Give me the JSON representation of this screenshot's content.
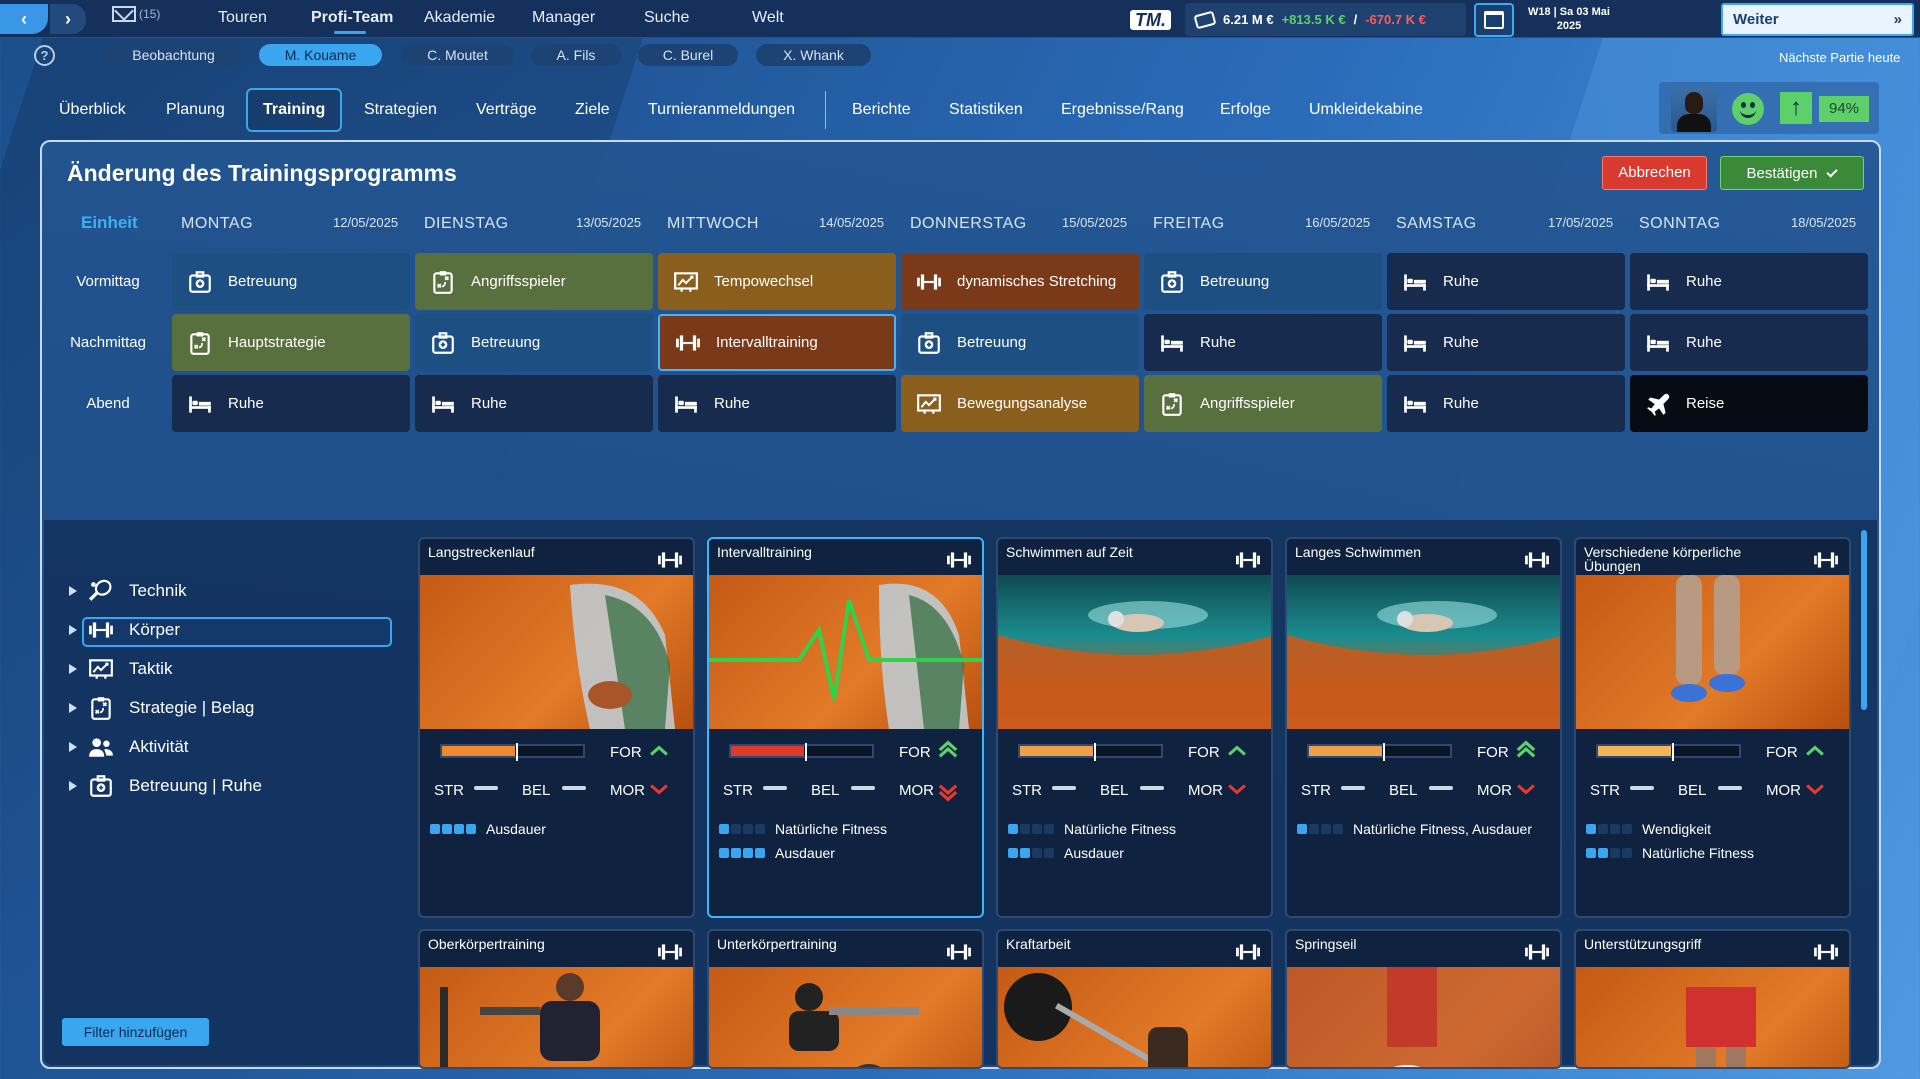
{
  "topbar": {
    "mail_count": "(15)",
    "nav": [
      "Touren",
      "Profi-Team",
      "Akademie",
      "Manager",
      "Suche",
      "Welt"
    ],
    "active_nav": "Profi-Team",
    "logo": "TM.",
    "finance": {
      "balance": "6.21 M €",
      "income": "+813.5 K €",
      "divider": "/",
      "expense": "-670.7 K €"
    },
    "date_line1": "W18 | Sa 03 Mai",
    "date_line2": "2025",
    "continue_label": "Weiter",
    "continue_icon": "»"
  },
  "players": {
    "help": "?",
    "tabs": [
      "Beobachtung",
      "M. Kouame",
      "C. Moutet",
      "A. Fils",
      "C. Burel",
      "X. Whank"
    ],
    "active": "M. Kouame",
    "next_match": "Nächste Partie heute"
  },
  "subtabs": {
    "items": [
      "Überblick",
      "Planung",
      "Training",
      "Strategien",
      "Verträge",
      "Ziele",
      "Turnieranmeldungen",
      "Berichte",
      "Statistiken",
      "Ergebnisse/Rang",
      "Erfolge",
      "Umkleidekabine"
    ],
    "active": "Training"
  },
  "player_status": {
    "form_pct": "94%",
    "mood": "happy",
    "trend": "up",
    "colors": {
      "good": "#5ed06a"
    }
  },
  "schedule": {
    "title": "Änderung des Trainingsprogramms",
    "cancel": "Abbrechen",
    "confirm": "Bestätigen",
    "unit_label": "Einheit",
    "days": [
      {
        "name": "MONTAG",
        "date": "12/05/2025"
      },
      {
        "name": "DIENSTAG",
        "date": "13/05/2025"
      },
      {
        "name": "MITTWOCH",
        "date": "14/05/2025"
      },
      {
        "name": "DONNERSTAG",
        "date": "15/05/2025"
      },
      {
        "name": "FREITAG",
        "date": "16/05/2025"
      },
      {
        "name": "SAMSTAG",
        "date": "17/05/2025"
      },
      {
        "name": "SONNTAG",
        "date": "18/05/2025"
      }
    ],
    "slots": [
      "Vormittag",
      "Nachmittag",
      "Abend"
    ],
    "grid": [
      [
        {
          "label": "Betreuung",
          "icon": "medkit-icon",
          "color": "blue"
        },
        {
          "label": "Angriffsspieler",
          "icon": "clipboard-icon",
          "color": "green"
        },
        {
          "label": "Tempowechsel",
          "icon": "tactics-board-icon",
          "color": "orange"
        },
        {
          "label": "dynamisches Stretching",
          "icon": "dumbbell-icon",
          "color": "brown"
        },
        {
          "label": "Betreuung",
          "icon": "medkit-icon",
          "color": "blue"
        },
        {
          "label": "Ruhe",
          "icon": "bed-icon",
          "color": "dark"
        },
        {
          "label": "Ruhe",
          "icon": "bed-icon",
          "color": "dark"
        }
      ],
      [
        {
          "label": "Hauptstrategie",
          "icon": "clipboard-icon",
          "color": "green"
        },
        {
          "label": "Betreuung",
          "icon": "medkit-icon",
          "color": "blue"
        },
        {
          "label": "Intervalltraining",
          "icon": "dumbbell-icon",
          "color": "brown",
          "selected": true
        },
        {
          "label": "Betreuung",
          "icon": "medkit-icon",
          "color": "blue"
        },
        {
          "label": "Ruhe",
          "icon": "bed-icon",
          "color": "dark"
        },
        {
          "label": "Ruhe",
          "icon": "bed-icon",
          "color": "dark"
        },
        {
          "label": "Ruhe",
          "icon": "bed-icon",
          "color": "dark"
        }
      ],
      [
        {
          "label": "Ruhe",
          "icon": "bed-icon",
          "color": "dark"
        },
        {
          "label": "Ruhe",
          "icon": "bed-icon",
          "color": "dark"
        },
        {
          "label": "Ruhe",
          "icon": "bed-icon",
          "color": "dark"
        },
        {
          "label": "Bewegungsanalyse",
          "icon": "tactics-board-icon",
          "color": "orange"
        },
        {
          "label": "Angriffsspieler",
          "icon": "clipboard-icon",
          "color": "green"
        },
        {
          "label": "Ruhe",
          "icon": "bed-icon",
          "color": "dark"
        },
        {
          "label": "Reise",
          "icon": "airplane-icon",
          "color": "black"
        }
      ]
    ]
  },
  "categories": {
    "items": [
      {
        "label": "Technik",
        "icon": "racket-icon"
      },
      {
        "label": "Körper",
        "icon": "dumbbell-icon"
      },
      {
        "label": "Taktik",
        "icon": "tactics-board-icon"
      },
      {
        "label": "Strategie | Belag",
        "icon": "clipboard-icon"
      },
      {
        "label": "Aktivität",
        "icon": "people-icon"
      },
      {
        "label": "Betreuung | Ruhe",
        "icon": "medkit-icon"
      }
    ],
    "selected": "Körper",
    "filter_button": "Filter hinzufügen"
  },
  "exercises": {
    "stat_labels": {
      "for": "FOR",
      "str": "STR",
      "bel": "BEL",
      "mor": "MOR"
    },
    "cards": [
      {
        "title": "Langstreckenlauf",
        "image": "runner-photo",
        "intensity": 0.5,
        "fill": "#f08a30",
        "for": "up",
        "for_level": 1,
        "mor": "down",
        "mor_level": 1,
        "req": [
          {
            "level": 4,
            "text": "Ausdauer"
          }
        ]
      },
      {
        "title": "Intervalltraining",
        "image": "runner-heartbeat-photo",
        "intensity": 0.5,
        "fill": "#e03a2a",
        "for": "up",
        "for_level": 2,
        "mor": "down",
        "mor_level": 2,
        "req": [
          {
            "level": 1,
            "text": "Natürliche Fitness"
          },
          {
            "level": 4,
            "text": "Ausdauer"
          }
        ],
        "selected": true
      },
      {
        "title": "Schwimmen auf Zeit",
        "image": "swimmer-photo",
        "intensity": 0.5,
        "fill": "#f0a04a",
        "for": "up",
        "for_level": 1,
        "mor": "down",
        "mor_level": 1,
        "req": [
          {
            "level": 1,
            "text": "Natürliche Fitness"
          },
          {
            "level": 2,
            "text": "Ausdauer"
          }
        ]
      },
      {
        "title": "Langes Schwimmen",
        "image": "swimmer-photo",
        "intensity": 0.5,
        "fill": "#f0a04a",
        "for": "up",
        "for_level": 2,
        "mor": "down",
        "mor_level": 1,
        "req": [
          {
            "level": 1,
            "text": "Natürliche Fitness, Ausdauer"
          }
        ]
      },
      {
        "title": "Verschiedene körperliche Übungen",
        "image": "legs-photo",
        "intensity": 0.5,
        "fill": "#f5b35a",
        "for": "up",
        "for_level": 1,
        "mor": "down",
        "mor_level": 1,
        "req": [
          {
            "level": 1,
            "text": "Wendigkeit"
          },
          {
            "level": 2,
            "text": "Natürliche Fitness"
          }
        ]
      },
      {
        "title": "Oberkörpertraining",
        "image": "gym-photo"
      },
      {
        "title": "Unterkörpertraining",
        "image": "bike-photo"
      },
      {
        "title": "Kraftarbeit",
        "image": "barbell-photo"
      },
      {
        "title": "Springseil",
        "image": "jumprope-photo"
      },
      {
        "title": "Unterstützungsgriff",
        "image": "support-photo"
      }
    ]
  }
}
